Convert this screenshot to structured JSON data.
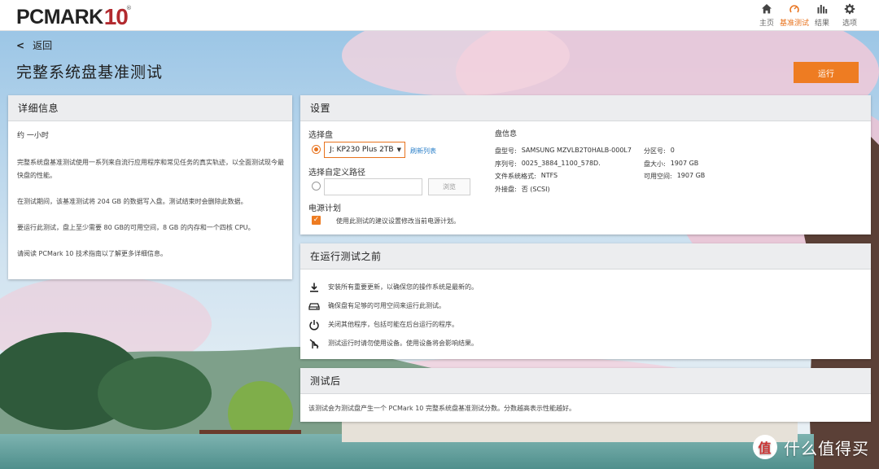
{
  "app": {
    "logo_main": "PCMARK",
    "logo_version": "10",
    "logo_reg": "®"
  },
  "nav": [
    {
      "label": "主页",
      "icon": "home-icon",
      "active": false
    },
    {
      "label": "基准测试",
      "icon": "gauge-icon",
      "active": true
    },
    {
      "label": "结果",
      "icon": "bar-chart-icon",
      "active": false
    },
    {
      "label": "选项",
      "icon": "gear-icon",
      "active": false
    }
  ],
  "colors": {
    "accent": "#ee7c22",
    "logo_red": "#b22a2f",
    "link": "#2a7fc9"
  },
  "header": {
    "back_label": "返回",
    "page_title": "完整系统盘基准测试",
    "run_button": "运行"
  },
  "details": {
    "title": "详细信息",
    "duration": "约 一小时",
    "paragraphs": [
      "完整系统盘基准测试使用一系列来自流行应用程序和常见任务的真实轨迹，以全面测试现今最快盘的性能。",
      "在测试期间，该基准测试将 204 GB 的数据写入盘。测试结束时会删除此数据。",
      "要运行此测试，盘上至少需要 80 GB的可用空间，8 GB 的内存和一个四核 CPU。",
      "请阅读 PCMark 10 技术指南以了解更多详细信息。"
    ]
  },
  "settings": {
    "title": "设置",
    "select_disk_label": "选择盘",
    "selected_disk": "J: KP230 Plus 2TB",
    "refresh_link": "刷新列表",
    "custom_path_label": "选择自定义路径",
    "custom_path_value": "",
    "browse_button": "浏览",
    "power_plan_label": "电源计划",
    "power_plan_checkbox": "使用此测试的建议设置修改当前电源计划。",
    "power_plan_checked": true
  },
  "disk_info": {
    "title": "盘信息",
    "model_label": "盘型号:",
    "model": "SAMSUNG MZVLB2T0HALB-000L7",
    "serial_label": "序列号:",
    "serial": "0025_3884_1100_578D.",
    "filesystem_label": "文件系统格式:",
    "filesystem": "NTFS",
    "external_label": "外接盘:",
    "external": "否 (SCSI)",
    "partition_label": "分区号:",
    "partition": "0",
    "size_label": "盘大小:",
    "size": "1907 GB",
    "free_label": "可用空间:",
    "free": "1907 GB"
  },
  "before": {
    "title": "在运行测试之前",
    "steps": [
      {
        "icon": "download-icon",
        "text": "安装所有重要更新，以确保您的操作系统是最新的。"
      },
      {
        "icon": "drive-icon",
        "text": "确保盘有足够的可用空间来运行此测试。"
      },
      {
        "icon": "power-icon",
        "text": "关闭其他程序，包括可能在后台运行的程序。"
      },
      {
        "icon": "no-touch-icon",
        "text": "测试运行时请勿使用设备。使用设备将会影响结果。"
      }
    ]
  },
  "after": {
    "title": "测试后",
    "text": "该测试会为测试盘产生一个 PCMark 10 完整系统盘基准测试分数。分数越高表示性能越好。"
  },
  "watermark": {
    "badge": "值",
    "text": "什么值得买"
  }
}
